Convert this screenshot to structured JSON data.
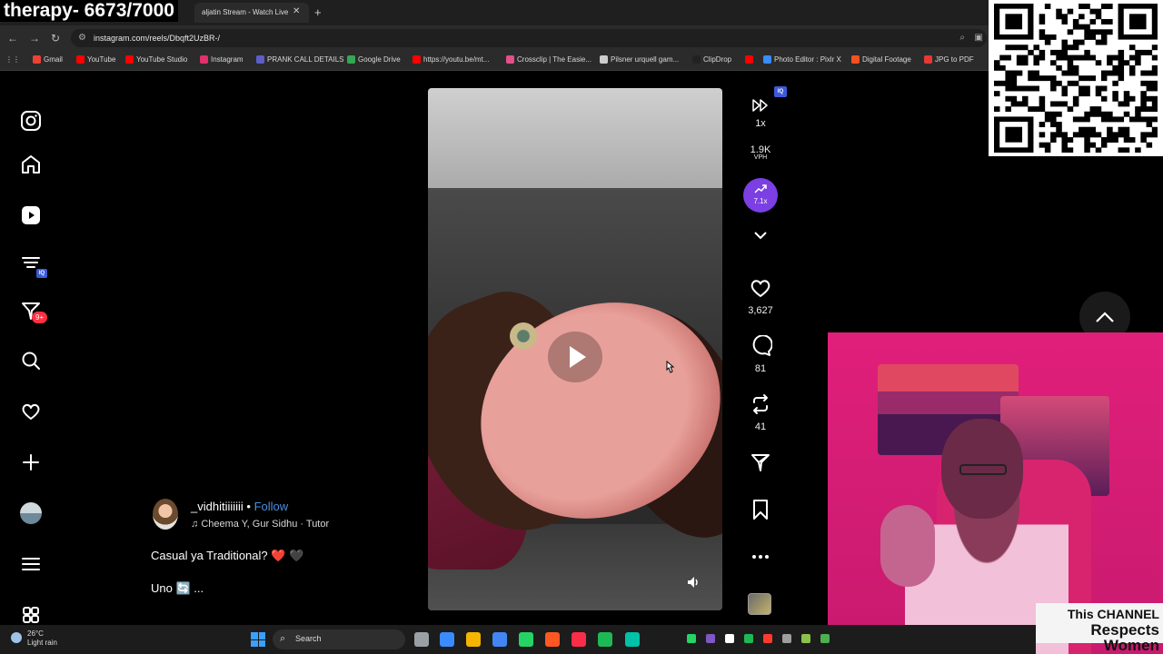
{
  "overlay": {
    "title": "therapy- 6673/7000"
  },
  "browser": {
    "tab_title": "aljatin Stream - Watch Live",
    "tab_close": "✕",
    "new_tab": "+",
    "url": "instagram.com/reels/Dbqft2UzBR-/",
    "bookmarks": [
      {
        "label": "Gmail",
        "color": "#ea4335"
      },
      {
        "label": "YouTube",
        "color": "#ff0000"
      },
      {
        "label": "YouTube Studio",
        "color": "#ff0000"
      },
      {
        "label": "Instagram",
        "color": "#e1306c"
      },
      {
        "label": "PRANK CALL DETAILS",
        "color": "#5b5fc7"
      },
      {
        "label": "Google Drive",
        "color": "#34a853"
      },
      {
        "label": "https://youtu.be/mt...",
        "color": "#ff0000"
      },
      {
        "label": "Crossclip | The Easie...",
        "color": "#e34f8a"
      },
      {
        "label": "Pilsner urquell gam...",
        "color": "#cccccc"
      },
      {
        "label": "ClipDrop",
        "color": "#222222"
      },
      {
        "label": "",
        "color": "#ff0000"
      },
      {
        "label": "Photo Editor : Pixlr X",
        "color": "#3a8bff"
      },
      {
        "label": "Digital Footage",
        "color": "#f4511e"
      },
      {
        "label": "JPG to PDF",
        "color": "#e53935"
      }
    ]
  },
  "sidebar": {
    "notification_badge": "9+",
    "iq_badge": "IQ"
  },
  "post": {
    "username": "_vidhitiiiiiii",
    "separator": " • ",
    "follow": "Follow",
    "music": "Cheema Y, Gur Sidhu · Tutor",
    "caption": "Casual ya Traditional? ❤️ 🖤",
    "caption_more": "Uno 🔄 ..."
  },
  "actions": {
    "iq_badge": "IQ",
    "speed": "1x",
    "vph_value": "1.9K",
    "vph_label": "VPH",
    "trend_value": "7.1x",
    "likes": "3,627",
    "comments": "81",
    "reposts": "41"
  },
  "webcam": {
    "watermark_line1": "This CHANNEL",
    "watermark_line2": "Respects Women"
  },
  "taskbar": {
    "temperature": "26°C",
    "weather": "Light rain",
    "search": "Search",
    "apps": [
      "#9aa0a6",
      "#3a8bff",
      "#f4b400",
      "#4285f4",
      "#25d366",
      "#ff5722",
      "#fa2d48",
      "#1db954",
      "#00c2a8"
    ],
    "tray": [
      "#25d366",
      "#7e57c2",
      "#ffffff",
      "#1db954",
      "#ff3b30",
      "#9e9e9e",
      "#8bc34a",
      "#4caf50"
    ]
  }
}
